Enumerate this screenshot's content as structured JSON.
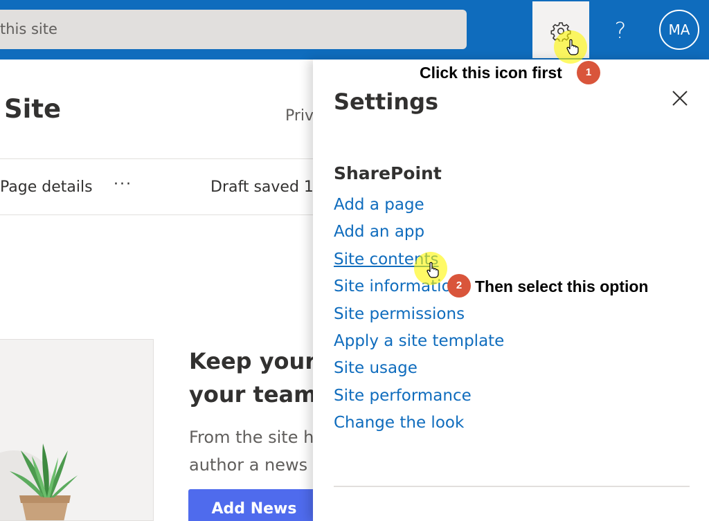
{
  "suite_bar": {
    "search_placeholder": "this site",
    "help_glyph": "?",
    "avatar_initials": "MA",
    "colors": {
      "bar": "#0f6cbd",
      "gear_cell": "#f3f2f1"
    }
  },
  "page": {
    "title": "Site",
    "privacy": "Priv",
    "command_bar": {
      "page_details": "Page details",
      "more_glyph": "···",
      "draft_status": "Draft saved 1"
    },
    "news_banner": {
      "heading": "Keep your t\nyour team :",
      "heading_line1": "Keep your t",
      "heading_line2": "your team :",
      "body_line1": "From the site h",
      "body_line2": "author a news",
      "add_news_label": "Add News"
    }
  },
  "settings_panel": {
    "title": "Settings",
    "section_heading": "SharePoint",
    "items": [
      {
        "label": "Add a page"
      },
      {
        "label": "Add an app"
      },
      {
        "label": "Site contents"
      },
      {
        "label": "Site information"
      },
      {
        "label": "Site permissions"
      },
      {
        "label": "Apply a site template"
      },
      {
        "label": "Site usage"
      },
      {
        "label": "Site performance"
      },
      {
        "label": "Change the look"
      }
    ],
    "link_color": "#0f6cbd"
  },
  "tutorial": {
    "step1": {
      "number": "1",
      "text": "Click this icon first"
    },
    "step2": {
      "number": "2",
      "text": "Then select this option"
    },
    "badge_color": "#d9553b",
    "highlight_color": "#fff600"
  },
  "icons": [
    "gear-icon",
    "help-icon",
    "close-icon",
    "hand-cursor-icon",
    "plant-illustration"
  ]
}
